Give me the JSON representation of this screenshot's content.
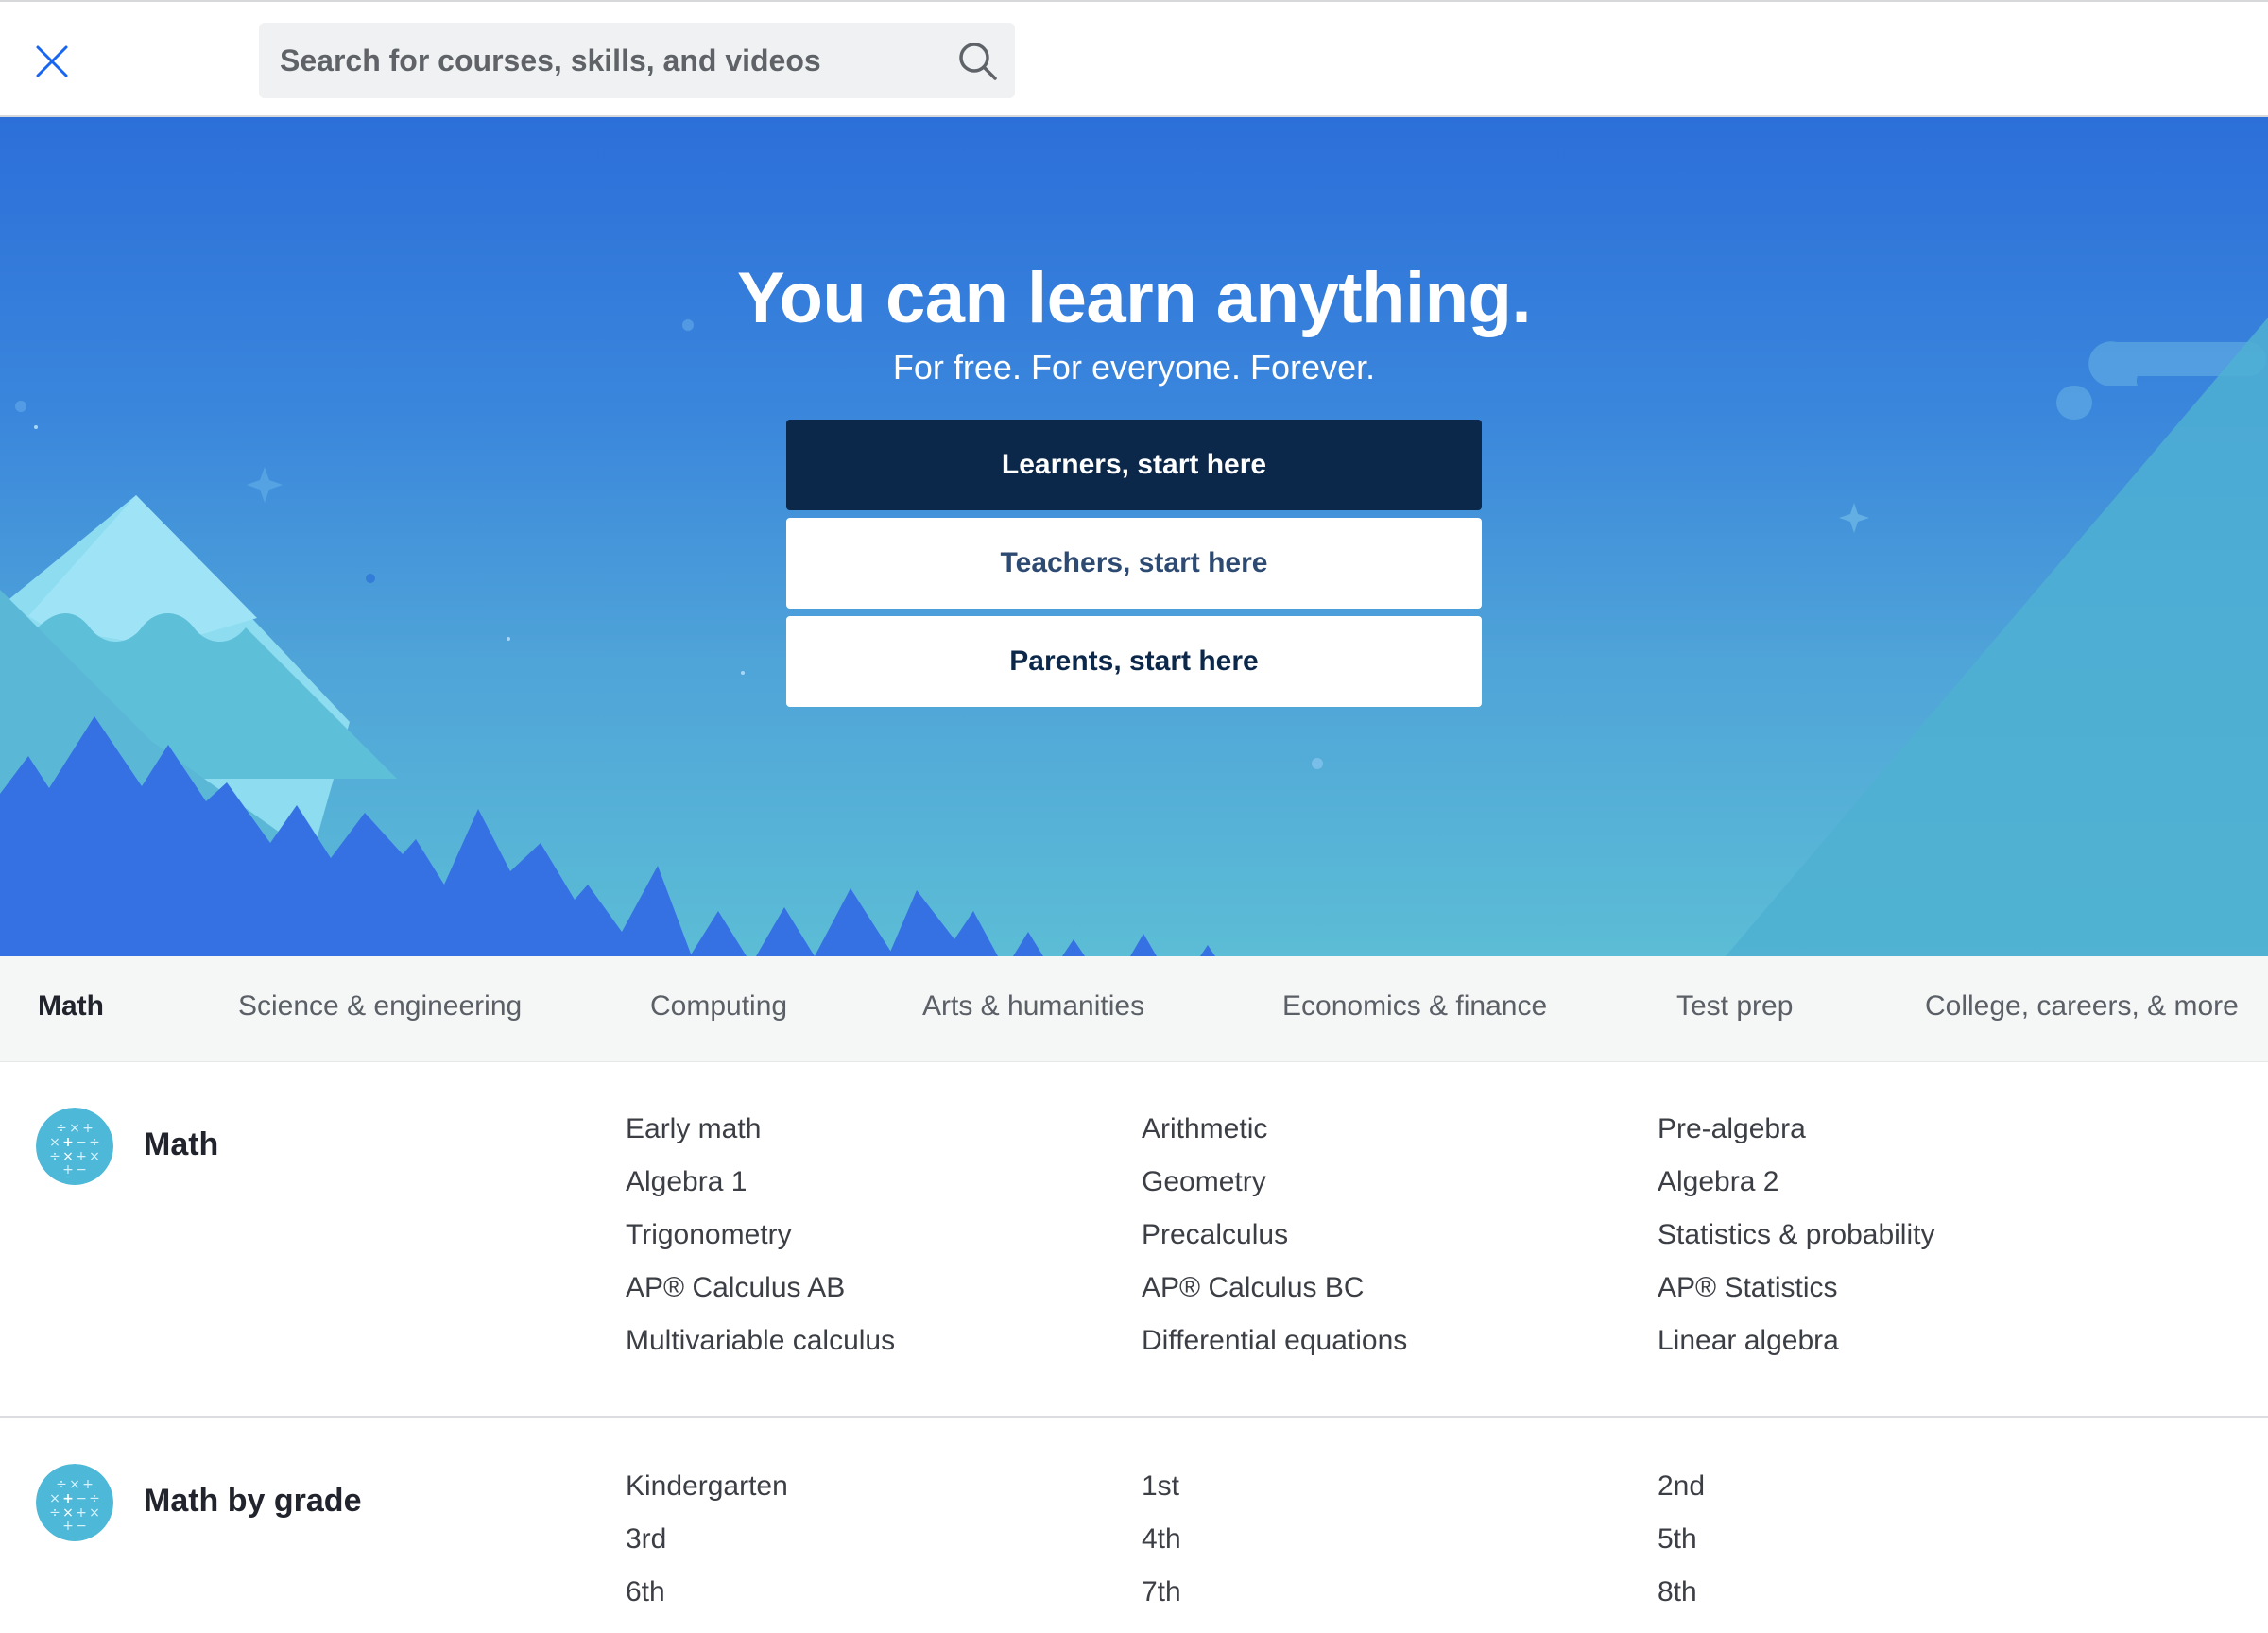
{
  "search": {
    "placeholder": "Search for courses, skills, and videos"
  },
  "icons": {
    "close": "close-icon",
    "search": "search-icon",
    "math": "math-icon"
  },
  "colors": {
    "hero_top": "#2c6fd9",
    "hero_bottom": "#5cbdd6",
    "learners_button": "#0b2749",
    "tab_bar": "#f5f6f6",
    "section_icon": "#4db8d8"
  },
  "hero": {
    "title": "You can learn anything.",
    "subtitle": "For free. For everyone. Forever.",
    "buttons": {
      "learners": "Learners, start here",
      "teachers": "Teachers, start here",
      "parents": "Parents, start here"
    }
  },
  "tabs": [
    {
      "label": "Math",
      "active": true
    },
    {
      "label": "Science & engineering",
      "active": false
    },
    {
      "label": "Computing",
      "active": false
    },
    {
      "label": "Arts & humanities",
      "active": false
    },
    {
      "label": "Economics & finance",
      "active": false
    },
    {
      "label": "Test prep",
      "active": false
    },
    {
      "label": "College, careers, & more",
      "active": false
    }
  ],
  "sections": [
    {
      "title": "Math",
      "courses": [
        "Early math",
        "Arithmetic",
        "Pre-algebra",
        "Algebra 1",
        "Geometry",
        "Algebra 2",
        "Trigonometry",
        "Precalculus",
        "Statistics & probability",
        "AP® Calculus AB",
        "AP® Calculus BC",
        "AP® Statistics",
        "Multivariable calculus",
        "Differential equations",
        "Linear algebra"
      ]
    },
    {
      "title": "Math by grade",
      "courses": [
        "Kindergarten",
        "1st",
        "2nd",
        "3rd",
        "4th",
        "5th",
        "6th",
        "7th",
        "8th"
      ]
    }
  ]
}
